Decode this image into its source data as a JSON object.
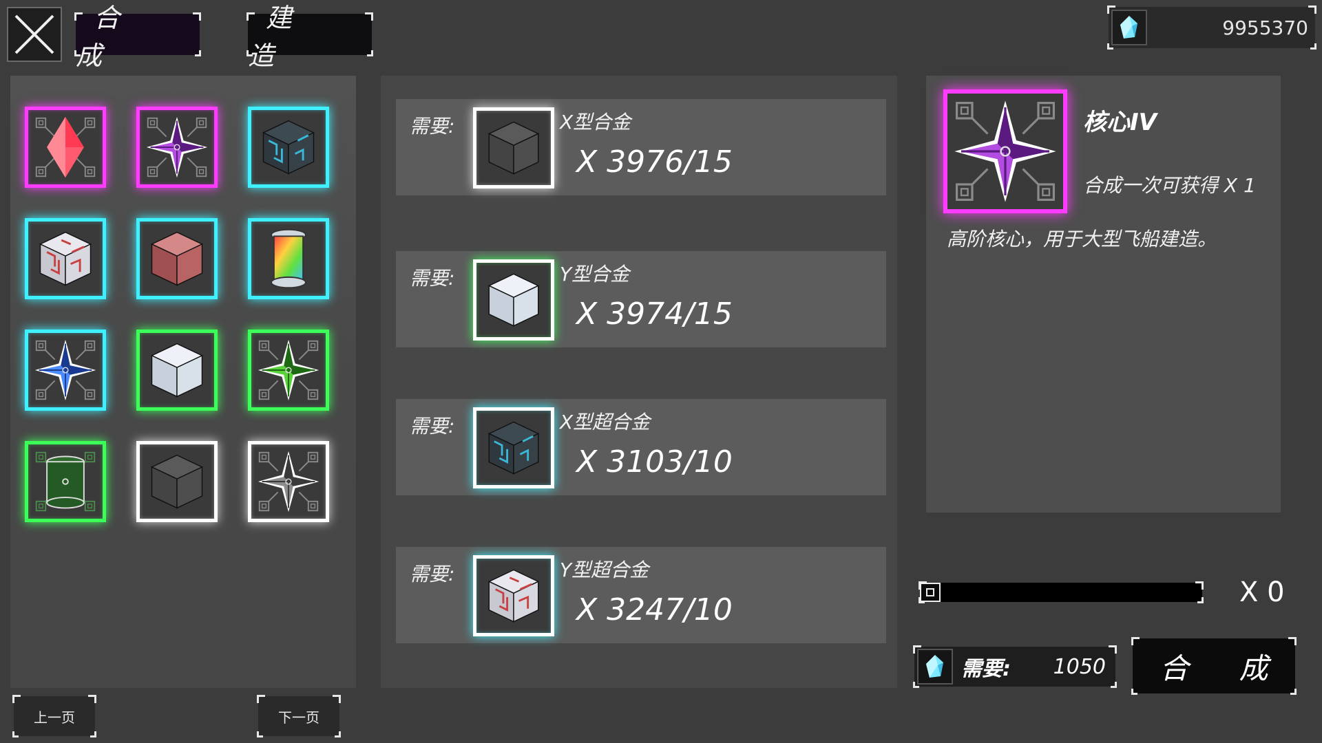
{
  "header": {
    "tabs": [
      {
        "label": "合 成",
        "active": true
      },
      {
        "label": "建 造",
        "active": false
      }
    ],
    "currency": {
      "icon": "crystal-icon",
      "value": "9955370"
    }
  },
  "inventory": {
    "items": [
      {
        "icon": "red-crystal-icon",
        "rarity": "magenta"
      },
      {
        "icon": "purple-core-icon",
        "rarity": "magenta"
      },
      {
        "icon": "dark-super-alloy-cube-icon",
        "rarity": "cyan"
      },
      {
        "icon": "red-pattern-cube-icon",
        "rarity": "cyan"
      },
      {
        "icon": "red-cube-icon",
        "rarity": "cyan"
      },
      {
        "icon": "rainbow-capsule-icon",
        "rarity": "cyan"
      },
      {
        "icon": "blue-core-icon",
        "rarity": "cyan"
      },
      {
        "icon": "white-cube-icon",
        "rarity": "green"
      },
      {
        "icon": "green-core-icon",
        "rarity": "green"
      },
      {
        "icon": "green-barrel-icon",
        "rarity": "green"
      },
      {
        "icon": "gray-cube-icon",
        "rarity": "white"
      },
      {
        "icon": "gray-core-icon",
        "rarity": "white"
      }
    ],
    "prev_label": "上一页",
    "next_label": "下一页"
  },
  "requirements": [
    {
      "label": "需要:",
      "name": "X型合金",
      "count": "X 3976/15",
      "rarity": "white",
      "icon": "gray-cube-icon"
    },
    {
      "label": "需要:",
      "name": "Y型合金",
      "count": "X 3974/15",
      "rarity": "green",
      "icon": "white-cube-icon"
    },
    {
      "label": "需要:",
      "name": "X型超合金",
      "count": "X 3103/10",
      "rarity": "cyan",
      "icon": "dark-super-alloy-cube-icon"
    },
    {
      "label": "需要:",
      "name": "Y型超合金",
      "count": "X 3247/10",
      "rarity": "cyan",
      "icon": "red-pattern-cube-icon"
    }
  ],
  "detail": {
    "name": "核心IV",
    "yield": "合成一次可获得 X 1",
    "description": "高阶核心，用于大型飞船建造。",
    "icon": "purple-core-icon"
  },
  "craft": {
    "quantity_label": "X 0",
    "quantity_fraction": 0,
    "cost_label": "需要:",
    "cost_value": "1050",
    "button_label": "合 成"
  },
  "colors": {
    "magenta": "#ff3cff",
    "cyan": "#3ff0ff",
    "green": "#3cff5a",
    "white": "#ffffff"
  }
}
